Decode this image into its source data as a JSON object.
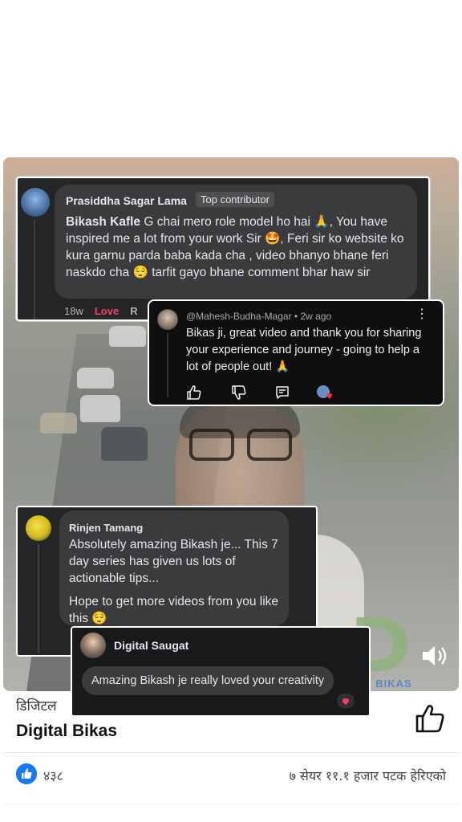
{
  "info": {
    "channel_np": "डिजिटल",
    "channel_en": "Digital Bikas",
    "likes": "४३८",
    "shares_views": "७ सेयर  ११.१ हजार पटक हेरिएको"
  },
  "video": {
    "logo_letter": "D",
    "logo_text": "l BIKAS"
  },
  "comment1": {
    "name": "Prasiddha Sagar Lama",
    "badge": "Top contributor",
    "mention": "Bikash Kafle",
    "text": " G chai mero role model ho hai 🙏, You have inspired me a lot from your work Sir 🤩, Feri sir ko website ko kura garnu parda baba kada cha , video bhanyo bhane feri naskdo cha 😌 tarfit gayo bhane comment bhar haw sir",
    "time": "18w",
    "reaction": "Love",
    "reply": "R"
  },
  "comment2": {
    "handle": "@Mahesh-Budha-Magar • 2w ago",
    "text": "Bikas ji, great video and thank you for sharing your experience and journey - going to help a lot of people out! 🙏"
  },
  "comment3": {
    "name": "Rinjen Tamang",
    "para1": "Absolutely amazing Bikash je... This 7 day series has given us lots of actionable tips...",
    "para2": "Hope to get more videos from you like this 😌"
  },
  "comment4": {
    "name": "Digital Saugat",
    "text": "Amazing Bikash je really loved your creativity"
  },
  "colors": {
    "facebook_blue": "#1877f2",
    "love_red": "#f3425f",
    "dark_panel": "#242526"
  }
}
